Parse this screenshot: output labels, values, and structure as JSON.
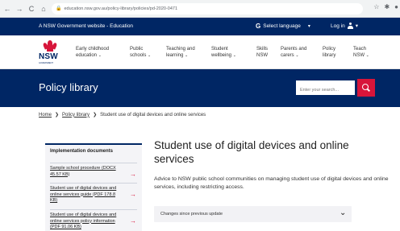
{
  "browser": {
    "back": "←",
    "forward": "→",
    "reload": "C",
    "home": "⌂",
    "url": "education.nsw.gov.au/policy-library/policies/pd-2020-0471",
    "lock": "🔒"
  },
  "govbar": {
    "text": "A NSW Government website - Education",
    "language_icon": "G",
    "language_label": "Select language",
    "chevron": "▾",
    "login_label": "Log in"
  },
  "logo": {
    "name": "NSW",
    "subtext": "GOVERNMENT"
  },
  "nav": {
    "items": [
      {
        "line1": "Early childhood",
        "line2": "education"
      },
      {
        "line1": "Public",
        "line2": "schools"
      },
      {
        "line1": "Teaching and",
        "line2": "learning"
      },
      {
        "line1": "Student",
        "line2": "wellbeing"
      },
      {
        "line1": "Skills",
        "line2": "NSW"
      },
      {
        "line1": "Parents and",
        "line2": "carers"
      },
      {
        "line1": "Policy",
        "line2": "library"
      },
      {
        "line1": "Teach",
        "line2": "NSW"
      }
    ],
    "chevron": "⌄"
  },
  "banner": {
    "title": "Policy library",
    "search_placeholder": "Enter your search..."
  },
  "breadcrumb": {
    "home": "Home",
    "library": "Policy library",
    "current": "Student use of digital devices and online services",
    "sep": "❯"
  },
  "sidebar": {
    "heading": "Implementation documents",
    "arrow": "→",
    "items": [
      {
        "label": "Sample school procedure (DOCX 45.57 KB)"
      },
      {
        "label": "Student use of digital devices and online services guide (PDF 178.8 KB)"
      },
      {
        "label": "Student use of digital devices and online services policy information (PDF 91.06 KB)"
      }
    ]
  },
  "article": {
    "title": "Student use of digital devices and online services",
    "intro": "Advice to NSW public school communities on managing student use of digital devices and online services, including restricting access.",
    "accordion_label": "Changes since previous update",
    "accordion_chevron": "⌄"
  },
  "colors": {
    "navy": "#002664",
    "red": "#d7153a"
  }
}
